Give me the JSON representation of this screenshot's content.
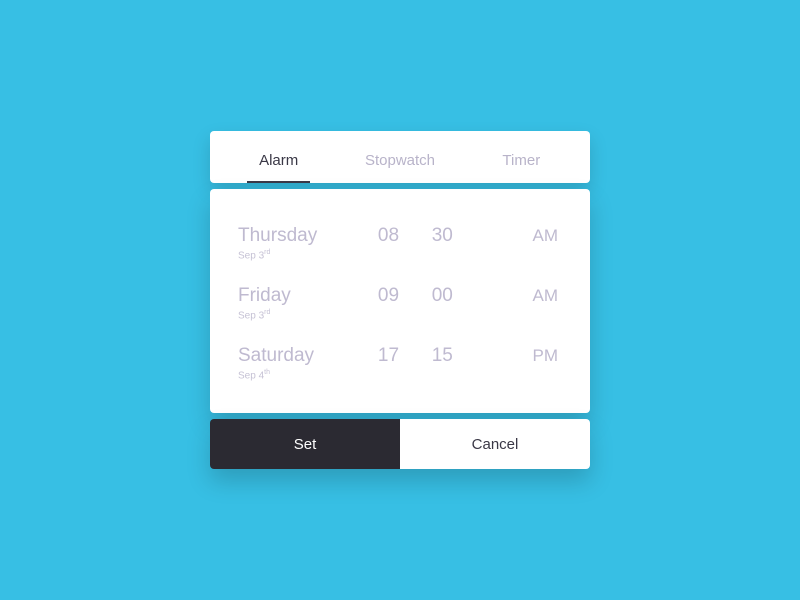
{
  "tabs": [
    {
      "label": "Alarm",
      "active": true
    },
    {
      "label": "Stopwatch",
      "active": false
    },
    {
      "label": "Timer",
      "active": false
    }
  ],
  "alarms": [
    {
      "day": "Thursday",
      "date_prefix": "Sep 3",
      "date_suffix": "rd",
      "hour": "08",
      "minute": "30",
      "period": "AM"
    },
    {
      "day": "Friday",
      "date_prefix": "Sep 3",
      "date_suffix": "rd",
      "hour": "09",
      "minute": "00",
      "period": "AM"
    },
    {
      "day": "Saturday",
      "date_prefix": "Sep 4",
      "date_suffix": "th",
      "hour": "17",
      "minute": "15",
      "period": "PM"
    }
  ],
  "actions": {
    "set_label": "Set",
    "cancel_label": "Cancel"
  }
}
